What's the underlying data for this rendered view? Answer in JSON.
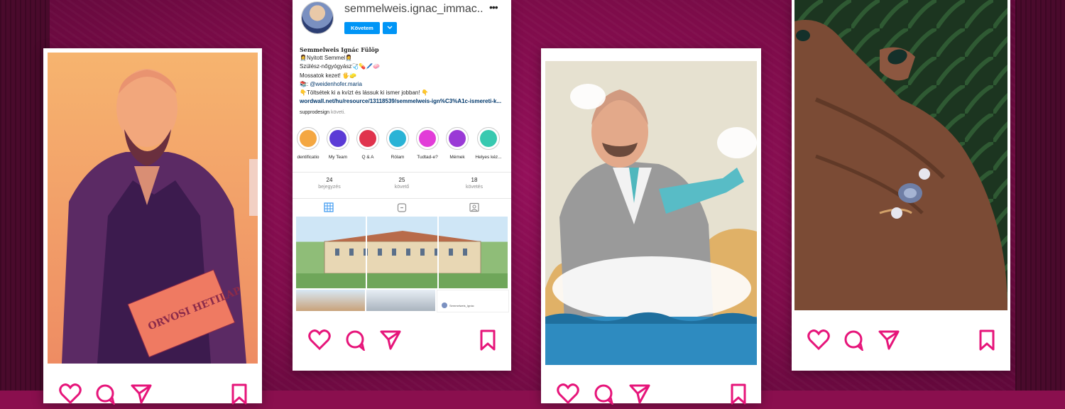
{
  "profile": {
    "username": "semmelweis.ignac_immac...",
    "more_label": "•••",
    "follow_label": "Követem",
    "dropdown_icon": "chevron-down-icon",
    "display_name": "Semmelweis Ignác Fülöp",
    "bio_lines": [
      "👩‍⚕️Nyitott Semmel👩‍⚕️",
      "Szülész-nőgyógyász🩺💊🖊️🧼",
      "Mossatok kezet! 🖐️🧽"
    ],
    "bio_mention_prefix": "📚: ",
    "bio_mention": "@weidenhofer.maria",
    "bio_cta": "👇Töltsétek ki a kvízt és lássuk ki ismer jobban! 👇",
    "bio_link": "wordwall.net/hu/resource/13118539/semmelweis-ign%C3%A1c-ismereti-k...",
    "followed_by_user": "supprodesign",
    "followed_by_text": " követi.",
    "highlights": [
      {
        "label": "dentificatio",
        "color": "#f4a742"
      },
      {
        "label": "My Team",
        "color": "#5b3bd6"
      },
      {
        "label": "Q & A",
        "color": "#e0334d"
      },
      {
        "label": "Rólam",
        "color": "#2ab3d6"
      },
      {
        "label": "Tudtad-e?",
        "color": "#e23dd8"
      },
      {
        "label": "Mémek",
        "color": "#9a3ad6"
      },
      {
        "label": "Helyes kéz...",
        "color": "#38c9b0"
      }
    ],
    "stats": [
      {
        "value": "24",
        "label": "bejegyzés"
      },
      {
        "value": "25",
        "label": "követő"
      },
      {
        "value": "18",
        "label": "követés"
      }
    ],
    "tabs": [
      "grid-icon",
      "reels-icon",
      "tagged-icon"
    ],
    "grid_thumb_caption": "Semmelweis_Ignác"
  },
  "cards": [
    {
      "name": "portrait-post",
      "actions": [
        "heart-icon",
        "comment-icon",
        "share-icon",
        "bookmark-icon"
      ]
    },
    {
      "name": "illustration-post",
      "actions": [
        "heart-icon",
        "comment-icon",
        "share-icon",
        "bookmark-icon"
      ]
    },
    {
      "name": "ring-post",
      "actions": [
        "heart-icon",
        "comment-icon",
        "share-icon",
        "bookmark-icon"
      ]
    }
  ],
  "colors": {
    "background": "#8a0f4e",
    "icon_pink": "#e6157a",
    "follow_blue": "#0095f6"
  }
}
